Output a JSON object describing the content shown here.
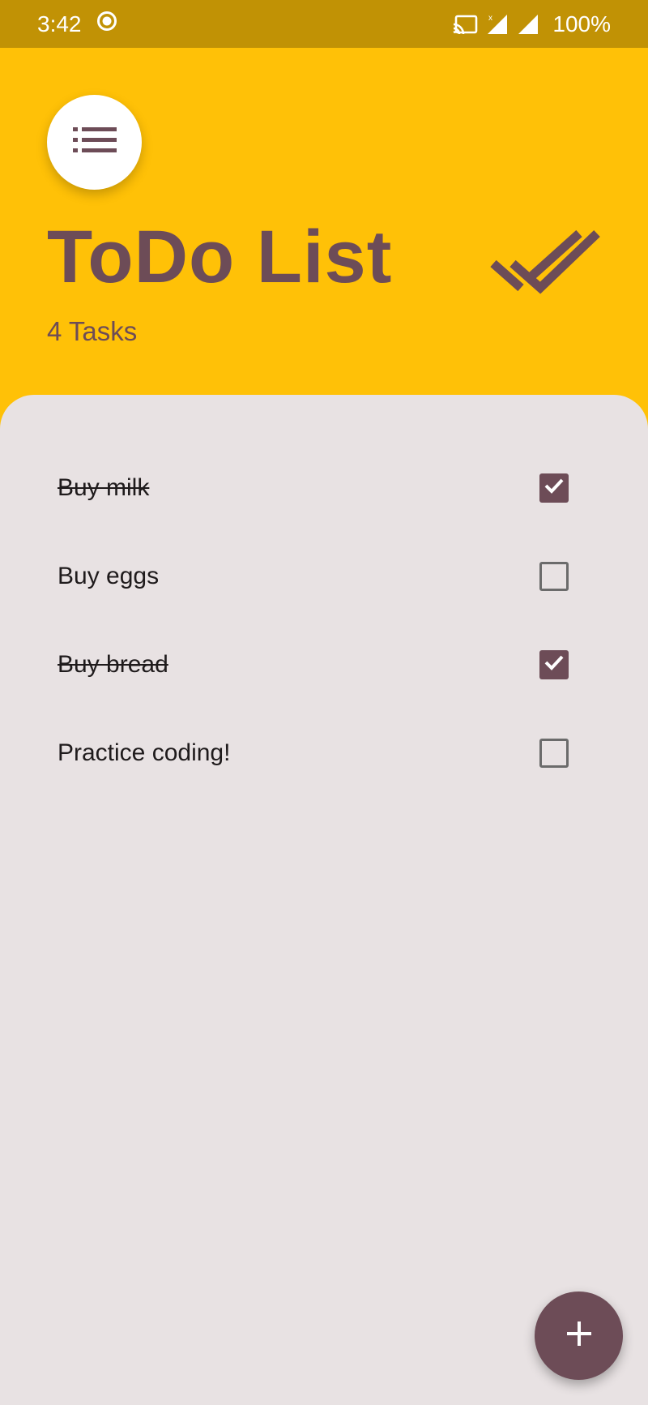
{
  "status_bar": {
    "time": "3:42",
    "battery": "100%",
    "icons": [
      "record-icon",
      "cast-icon",
      "signal-icon",
      "signal-icon",
      "battery-text"
    ]
  },
  "header": {
    "title": "ToDo List",
    "task_count": "4 Tasks",
    "menu_icon": "list-icon",
    "done_icon": "done-all-icon"
  },
  "tasks": [
    {
      "label": "Buy milk",
      "done": true
    },
    {
      "label": "Buy eggs",
      "done": false
    },
    {
      "label": "Buy bread",
      "done": true
    },
    {
      "label": "Practice coding!",
      "done": false
    }
  ],
  "fab": {
    "icon": "add-icon"
  },
  "colors": {
    "header_bg": "#ffc107",
    "status_bar_bg": "#c19205",
    "accent": "#6d4c57",
    "sheet_bg": "#e8e2e3"
  }
}
